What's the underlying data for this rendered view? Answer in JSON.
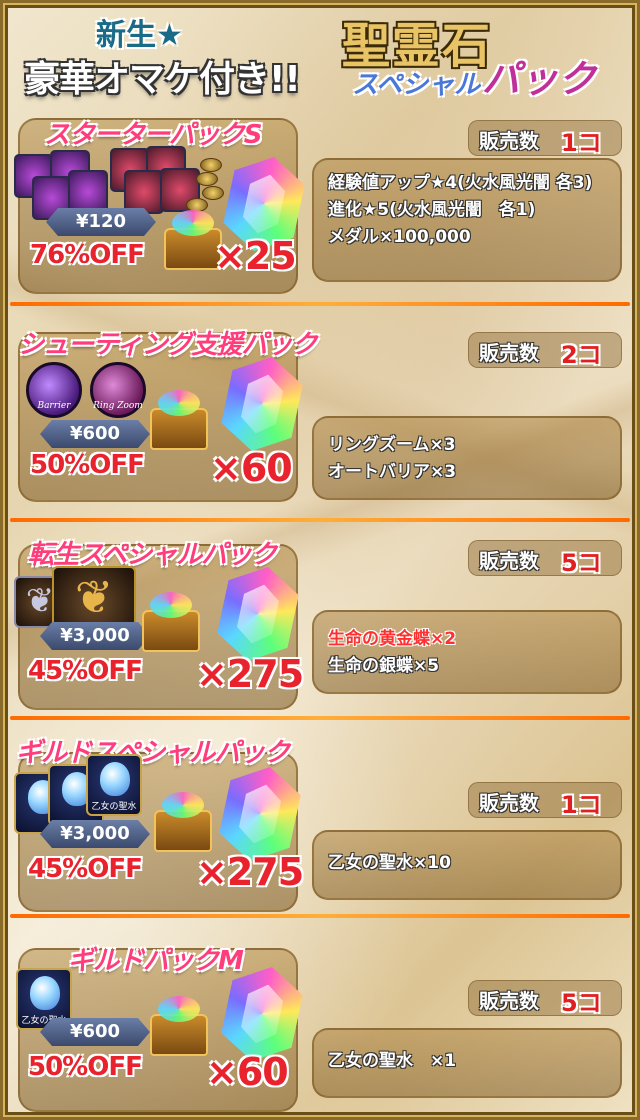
{
  "header": {
    "line1": "新生★",
    "line2": "豪華オマケ付き!!",
    "title_main": "聖霊石",
    "title_sub1": "スペシャル",
    "title_sub2": "パック"
  },
  "sold_label": "販売数",
  "packs": [
    {
      "title": "スターターパックS",
      "price": "¥120",
      "discount": "76%OFF",
      "multiplier": "×25",
      "sold": "1コ",
      "contents": [
        "経験値アップ★4(火水風光闇 各3)",
        "進化★5(火水風光闇　各1)",
        "メダル×100,000"
      ],
      "highlight_first": false
    },
    {
      "title": "シューティング支援パック",
      "price": "¥600",
      "discount": "50%OFF",
      "multiplier": "×60",
      "sold": "2コ",
      "contents": [
        "リングズーム×3",
        "オートバリア×3"
      ],
      "icons": [
        "Barrier",
        "Ring Zoom"
      ],
      "highlight_first": false
    },
    {
      "title": "転生スペシャルパック",
      "price": "¥3,000",
      "discount": "45%OFF",
      "multiplier": "×275",
      "sold": "5コ",
      "contents": [
        "生命の黄金蝶×2",
        "生命の銀蝶×5"
      ],
      "highlight_first": true
    },
    {
      "title": "ギルドスペシャルパック",
      "price": "¥3,000",
      "discount": "45%OFF",
      "multiplier": "×275",
      "sold": "1コ",
      "contents": [
        "乙女の聖水×10"
      ],
      "icon_label": "乙女の聖水",
      "highlight_first": false
    },
    {
      "title": "ギルドパックM",
      "price": "¥600",
      "discount": "50%OFF",
      "multiplier": "×60",
      "sold": "5コ",
      "contents": [
        "乙女の聖水　×1"
      ],
      "icon_label": "乙女の聖水",
      "highlight_first": false
    }
  ],
  "colors": {
    "accent_red": "#e8232d",
    "title_pink": "#ff3d7a",
    "divider_orange": "#ff8a1a",
    "gold": "#e9c467"
  }
}
